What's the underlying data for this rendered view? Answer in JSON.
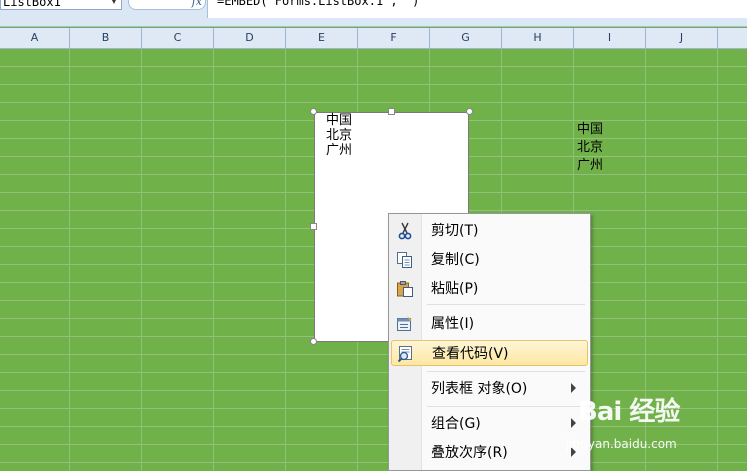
{
  "formula_bar": {
    "name_box": "ListBox1",
    "fx_label": "fx",
    "formula": "=EMBED(\"Forms.ListBox.1\",\"\")"
  },
  "columns": [
    "A",
    "B",
    "C",
    "D",
    "E",
    "F",
    "G",
    "H",
    "I",
    "J"
  ],
  "cells": {
    "column_I": [
      "中国",
      "北京",
      "广州"
    ]
  },
  "listbox": {
    "items": [
      "中国",
      "北京",
      "广州"
    ]
  },
  "context_menu": {
    "items": [
      {
        "label": "剪切(T)",
        "icon": "scissors-icon"
      },
      {
        "label": "复制(C)",
        "icon": "copy-icon"
      },
      {
        "label": "粘贴(P)",
        "icon": "paste-icon"
      },
      {
        "label": "属性(I)",
        "icon": "properties-icon"
      },
      {
        "label": "查看代码(V)",
        "icon": "view-code-icon",
        "highlighted": true
      },
      {
        "label": "列表框 对象(O)",
        "submenu": true
      },
      {
        "label": "组合(G)",
        "submenu": true
      },
      {
        "label": "叠放次序(R)",
        "submenu": true
      }
    ]
  },
  "watermark": {
    "brand": "Bai 经验",
    "url": "jingyan.baidu.com"
  },
  "colors": {
    "sheet_background": "#70b14a",
    "menu_highlight": "#fde7a2"
  }
}
